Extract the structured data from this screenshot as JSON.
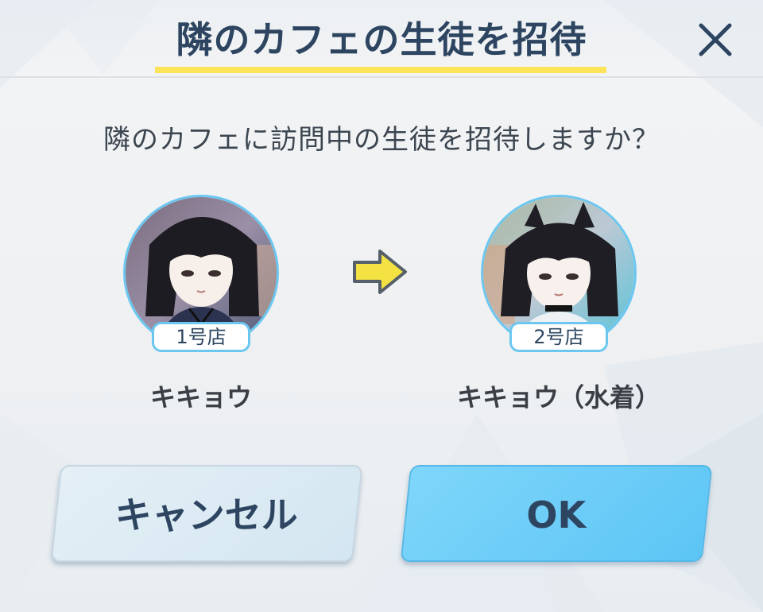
{
  "dialog": {
    "title": "隣のカフェの生徒を招待",
    "message": "隣のカフェに訪問中の生徒を招待しますか？",
    "close_icon": "close-icon"
  },
  "students": {
    "from": {
      "store": "1号店",
      "name": "キキョウ"
    },
    "to": {
      "store": "2号店",
      "name": "キキョウ（水着）"
    },
    "arrow_icon": "arrow-right-icon"
  },
  "buttons": {
    "cancel": "キャンセル",
    "ok": "OK"
  },
  "colors": {
    "title": "#2d4560",
    "underline": "#fbe45a",
    "ok_button": "#5cc5f5",
    "cancel_button": "#d4e6f1",
    "avatar_border": "#6cc7f0"
  }
}
